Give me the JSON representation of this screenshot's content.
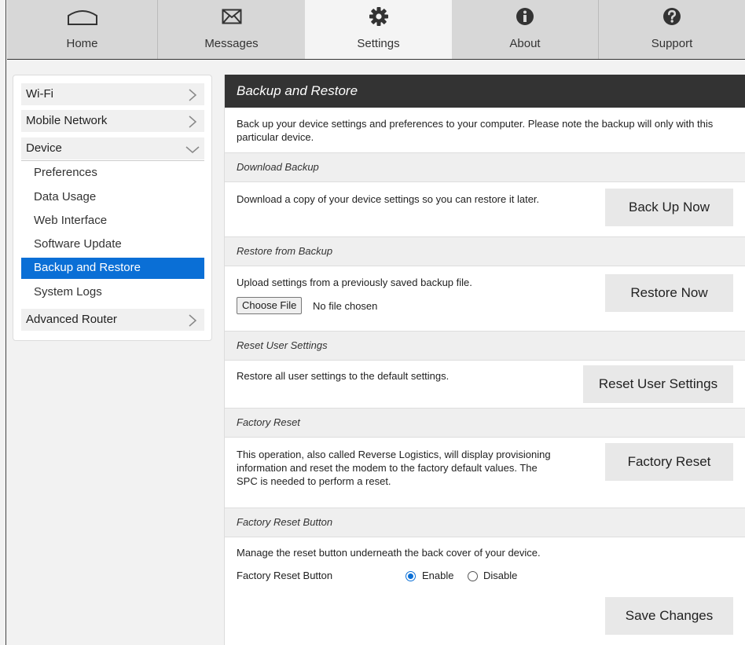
{
  "nav": {
    "tabs": [
      {
        "label": "Home",
        "icon": "home-icon"
      },
      {
        "label": "Messages",
        "icon": "envelope-icon"
      },
      {
        "label": "Settings",
        "icon": "gear-icon"
      },
      {
        "label": "About",
        "icon": "info-icon"
      },
      {
        "label": "Support",
        "icon": "question-icon"
      }
    ],
    "active": "Settings"
  },
  "sidebar": {
    "items": [
      {
        "label": "Wi-Fi"
      },
      {
        "label": "Mobile Network"
      },
      {
        "label": "Device"
      },
      {
        "label": "Advanced Router"
      }
    ],
    "device_subitems": [
      {
        "label": "Preferences"
      },
      {
        "label": "Data Usage"
      },
      {
        "label": "Web Interface"
      },
      {
        "label": "Software Update"
      },
      {
        "label": "Backup and Restore"
      },
      {
        "label": "System Logs"
      }
    ],
    "active_subitem": "Backup and Restore"
  },
  "main": {
    "title": "Backup and Restore",
    "intro": "Back up your device settings and preferences to your computer. Please note the backup will only with this particular device.",
    "download": {
      "heading": "Download Backup",
      "text": "Download a copy of your device settings so you can restore it later.",
      "button": "Back Up Now"
    },
    "restore": {
      "heading": "Restore from Backup",
      "text": "Upload settings from a previously saved backup file.",
      "choose_file": "Choose File",
      "no_file": "No file chosen",
      "button": "Restore Now"
    },
    "reset_user": {
      "heading": "Reset User Settings",
      "text": "Restore all user settings to the default settings.",
      "button": "Reset User Settings"
    },
    "factory": {
      "heading": "Factory Reset",
      "text": "This operation, also called Reverse Logistics, will display provisioning information and reset the modem to the factory default values. The SPC is needed to perform a reset.",
      "button": "Factory Reset"
    },
    "factory_button": {
      "heading": "Factory Reset Button",
      "text": "Manage the reset button underneath the back cover of your device.",
      "field_label": "Factory Reset Button",
      "enable": "Enable",
      "disable": "Disable",
      "selected": "Enable",
      "save": "Save Changes"
    }
  },
  "colors": {
    "accent": "#0a6fd6",
    "header": "#333333",
    "tab_bg": "#d7d7d7"
  }
}
